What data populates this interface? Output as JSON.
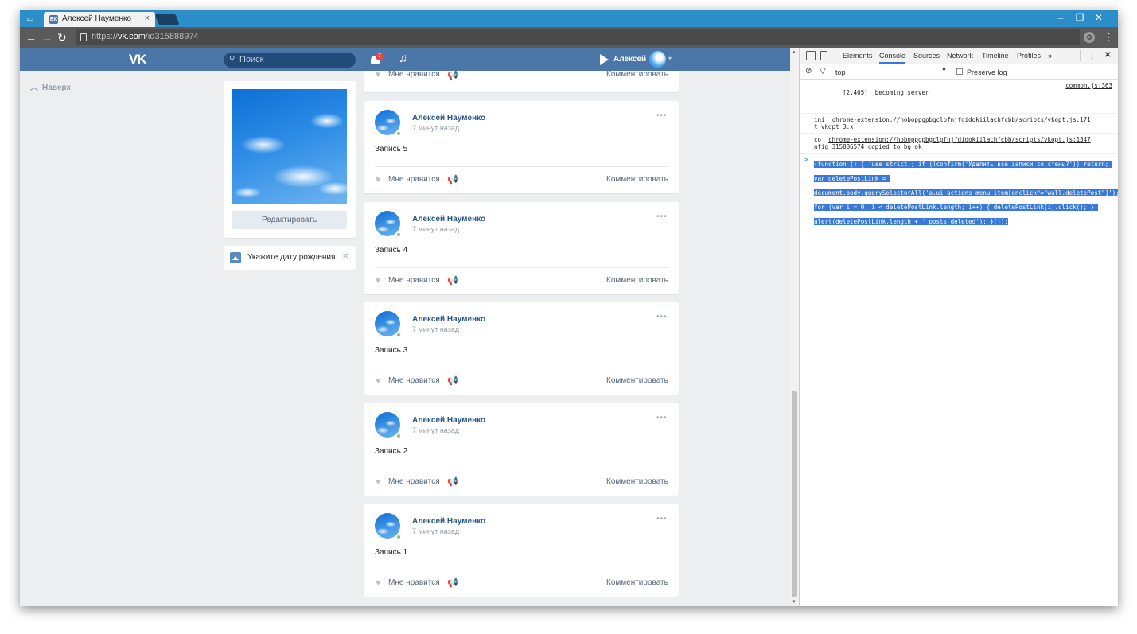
{
  "browser": {
    "tab_title": "Алексей Науменко",
    "tab_close": "×",
    "url_prefix": "https://",
    "url_domain": "vk.com",
    "url_path": "/id315888974",
    "win_minimize": "–",
    "win_restore": "❐",
    "win_close": "✕"
  },
  "vk": {
    "logo": "VK",
    "search_placeholder": "Поиск",
    "notifications_count": "7",
    "user_name": "Алексей",
    "back_to_top": "Наверх",
    "edit_button": "Редактировать",
    "birthday_prompt": "Укажите дату рождения",
    "like_label": "Мне нравится",
    "comment_label": "Комментировать",
    "posts": [
      {
        "author": "Алексей Науменко",
        "time": "7 минут назад",
        "text": "Запись 5"
      },
      {
        "author": "Алексей Науменко",
        "time": "7 минут назад",
        "text": "Запись 4"
      },
      {
        "author": "Алексей Науменко",
        "time": "7 минут назад",
        "text": "Запись 3"
      },
      {
        "author": "Алексей Науменко",
        "time": "7 минут назад",
        "text": "Запись 2"
      },
      {
        "author": "Алексей Науменко",
        "time": "7 минут назад",
        "text": "Запись 1"
      }
    ]
  },
  "devtools": {
    "tabs": [
      "Elements",
      "Console",
      "Sources",
      "Network",
      "Timeline",
      "Profiles"
    ],
    "more": "»",
    "context": "top",
    "preserve_log": "Preserve log",
    "logs": [
      {
        "text": "[2.405]  becoming server",
        "source": "common.js:363"
      },
      {
        "prefix": "ini  ",
        "link": "chrome-extension://hoboppgpbgclpfnjfdidokiilachfcbb/scripts/vkopt.js:171",
        "rest": "t vkopt 3.x"
      },
      {
        "prefix": "co  ",
        "link": "chrome-extension://hoboppgpbgclpfnjfdidokiilachfcbb/scripts/vkopt.js:1347",
        "rest": "nfig 315886574 copied to bg ok"
      }
    ],
    "input_code": "(function () { 'use strict'; if (!confirm('Удалить все записи со стены?')) return; var deletePostLink = document.body.querySelectorAll('a.ui_actions_menu_item[onclick^=\"wall.deletePost\"]'); for (var i = 0; i < deletePostLink.length; i++) { deletePostLink[i].click(); } alert(deletePostLink.length + ' posts deleted'); }());"
  },
  "icons": {
    "back": "arrow-left-icon",
    "forward": "arrow-right-icon",
    "reload": "reload-icon",
    "bell": "bell-icon",
    "music": "music-note-icon",
    "like": "heart-icon",
    "share": "megaphone-icon"
  },
  "colors": {
    "vk_blue": "#4a76a8",
    "title_bar": "#2b8ec8",
    "selection": "#3879d9"
  }
}
